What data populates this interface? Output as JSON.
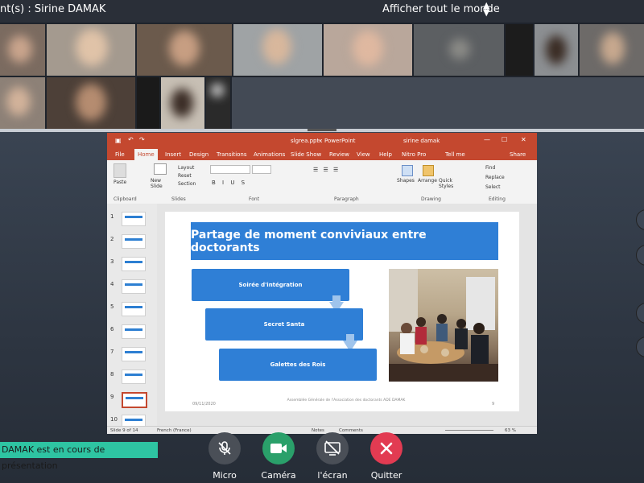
{
  "topbar": {
    "title": "nt(s) : Sirine DAMAK",
    "show_all": "Afficher tout le monde",
    "chevron_icon": "chevron-updown-icon"
  },
  "ppt": {
    "file_name": "slgrea.pptx",
    "app_name": "PowerPoint",
    "user_name": "sirine damak",
    "tabs": [
      "File",
      "Home",
      "Insert",
      "Design",
      "Transitions",
      "Animations",
      "Slide Show",
      "Review",
      "View",
      "Help",
      "Nitro Pro",
      "Tell me",
      "Share"
    ],
    "active_tab": "Home",
    "ribbon": {
      "paste": "Paste",
      "clipboard": "Clipboard",
      "new_slide": "New Slide",
      "layout": "Layout",
      "reset": "Reset",
      "section": "Section",
      "slides": "Slides",
      "font": "Font",
      "paragraph": "Paragraph",
      "shapes": "Shapes",
      "arrange": "Arrange",
      "quick_styles": "Quick Styles",
      "drawing": "Drawing",
      "find": "Find",
      "replace": "Replace",
      "select": "Select",
      "editing": "Editing"
    },
    "thumb_numbers": [
      "1",
      "2",
      "3",
      "4",
      "5",
      "6",
      "7",
      "8",
      "9",
      "10"
    ],
    "selected_thumb": 9,
    "slide": {
      "title": "Partage de moment conviviaux entre doctorants",
      "box1": "Soirée d'intégration",
      "box2": "Secret Santa",
      "box3": "Galettes des Rois",
      "date": "09/11/2020",
      "footer": "Assemblée Générale de l'Association des doctorants ADE DAMAK",
      "page": "9"
    },
    "status": {
      "slide_of": "Slide 9 of 14",
      "language": "French (France)",
      "notes": "Notes",
      "comments": "Comments",
      "zoom": "63 %"
    }
  },
  "banner": "DAMAK est en cours de présentation",
  "controls": [
    {
      "label": "Micro",
      "icon": "mic-off-icon",
      "color": "#4a4f57"
    },
    {
      "label": "Caméra",
      "icon": "camera-icon",
      "color": "#2aa06a"
    },
    {
      "label": "l'écran",
      "icon": "screen-share-off-icon",
      "color": "#4a4f57"
    },
    {
      "label": "Quitter",
      "icon": "close-icon",
      "color": "#e23b52"
    }
  ]
}
